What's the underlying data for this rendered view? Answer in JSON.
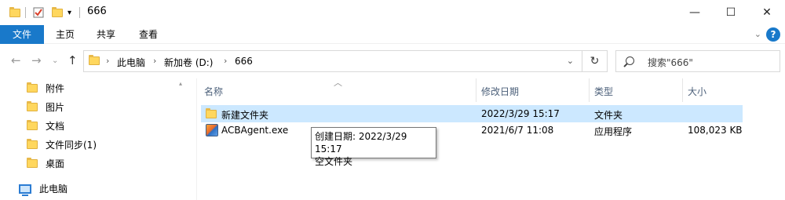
{
  "window": {
    "title": "666",
    "controls": {
      "minimize": "—",
      "maximize": "☐",
      "close": "✕"
    }
  },
  "ribbon": {
    "tabs": [
      "文件",
      "主页",
      "共享",
      "查看"
    ],
    "help": "?"
  },
  "address_bar": {
    "crumbs": [
      "此电脑",
      "新加卷 (D:)",
      "666"
    ]
  },
  "search": {
    "placeholder": "搜索\"666\""
  },
  "sidebar": {
    "items": [
      "附件",
      "图片",
      "文档",
      "文件同步(1)",
      "桌面"
    ],
    "this_pc": "此电脑"
  },
  "columns": {
    "name": "名称",
    "date": "修改日期",
    "type": "类型",
    "size": "大小"
  },
  "files": [
    {
      "name": "新建文件夹",
      "date": "2022/3/29 15:17",
      "type": "文件夹",
      "size": "",
      "icon": "folder-icon",
      "selected": true
    },
    {
      "name": "ACBAgent.exe",
      "date": "2021/6/7 11:08",
      "type": "应用程序",
      "size": "108,023 KB",
      "icon": "exe-icon",
      "selected": false
    }
  ],
  "tooltip": {
    "line1": "创建日期: 2022/3/29 15:17",
    "line2": "空文件夹"
  }
}
